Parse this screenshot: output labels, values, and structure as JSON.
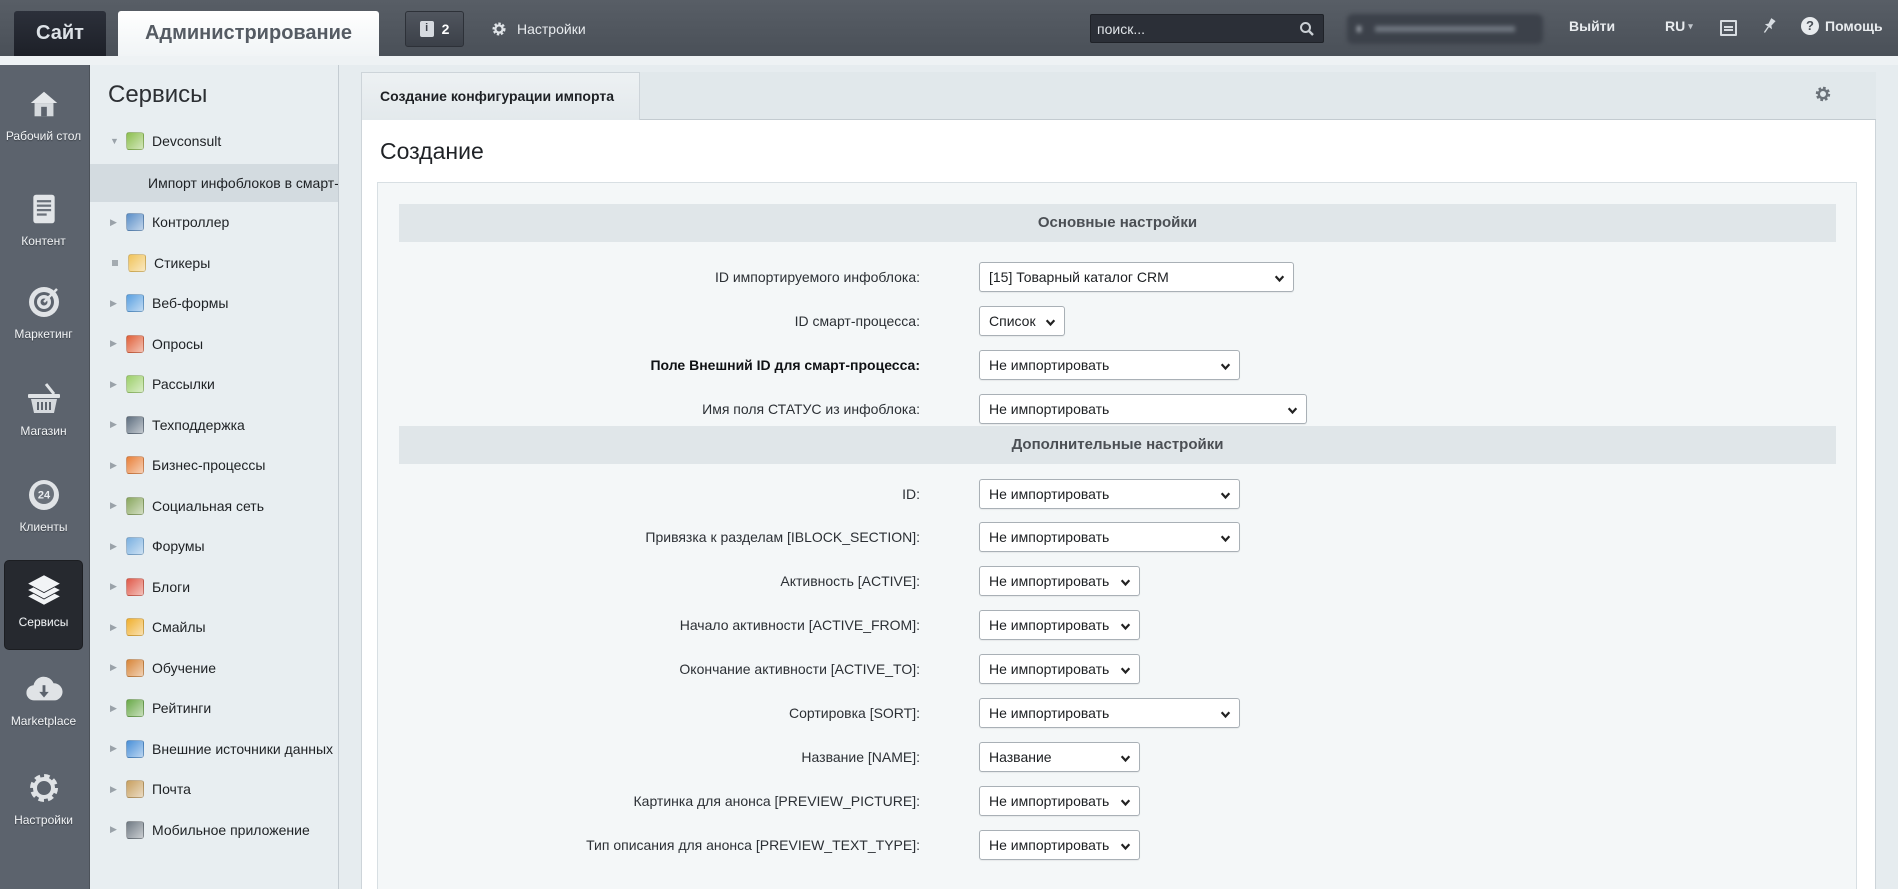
{
  "topbar": {
    "site_label": "Сайт",
    "admin_label": "Администрирование",
    "notifications_count": "2",
    "notifications_icon": "info-icon",
    "settings_label": "Настройки",
    "search_placeholder": "поиск...",
    "logout_label": "Выйти",
    "language_label": "RU",
    "help_label": "Помощь"
  },
  "iconbar": {
    "items": [
      {
        "label": "Рабочий стол",
        "icon": "home-icon",
        "active": false
      },
      {
        "label": "Контент",
        "icon": "document-icon",
        "active": false
      },
      {
        "label": "Маркетинг",
        "icon": "target-icon",
        "active": false
      },
      {
        "label": "Магазин",
        "icon": "basket-icon",
        "active": false
      },
      {
        "label": "Клиенты",
        "icon": "clients-24-icon",
        "active": false
      },
      {
        "label": "Сервисы",
        "icon": "layers-icon",
        "active": true
      },
      {
        "label": "Marketplace",
        "icon": "cloud-download-icon",
        "active": false
      },
      {
        "label": "Настройки",
        "icon": "gear-icon",
        "active": false
      }
    ]
  },
  "tree": {
    "title": "Сервисы",
    "items": [
      {
        "label": "Devconsult",
        "state": "expanded",
        "icon_color": "#8cbf4f"
      },
      {
        "label": "Импорт инфоблоков в смарт-процессы",
        "state": "child-selected"
      },
      {
        "label": "Контроллер",
        "state": "collapsed",
        "icon_color": "#5b8fc8"
      },
      {
        "label": "Стикеры",
        "state": "leaf",
        "icon_color": "#f0c35a"
      },
      {
        "label": "Веб-формы",
        "state": "collapsed",
        "icon_color": "#5aa0e0"
      },
      {
        "label": "Опросы",
        "state": "collapsed",
        "icon_color": "#e0603a"
      },
      {
        "label": "Рассылки",
        "state": "collapsed",
        "icon_color": "#9ccf6a"
      },
      {
        "label": "Техподдержка",
        "state": "collapsed",
        "icon_color": "#5f6f80"
      },
      {
        "label": "Бизнес-процессы",
        "state": "collapsed",
        "icon_color": "#e8803a"
      },
      {
        "label": "Социальная сеть",
        "state": "collapsed",
        "icon_color": "#8aa860"
      },
      {
        "label": "Форумы",
        "state": "collapsed",
        "icon_color": "#7ab0e0"
      },
      {
        "label": "Блоги",
        "state": "collapsed",
        "icon_color": "#e05a4a"
      },
      {
        "label": "Смайлы",
        "state": "collapsed",
        "icon_color": "#f0b030"
      },
      {
        "label": "Обучение",
        "state": "collapsed",
        "icon_color": "#d8863a"
      },
      {
        "label": "Рейтинги",
        "state": "collapsed",
        "icon_color": "#6aaa4a"
      },
      {
        "label": "Внешние источники данных",
        "state": "collapsed",
        "icon_color": "#4a90d8"
      },
      {
        "label": "Почта",
        "state": "collapsed",
        "icon_color": "#c8a060"
      },
      {
        "label": "Мобильное приложение",
        "state": "collapsed",
        "icon_color": "#707a84"
      }
    ]
  },
  "content": {
    "tab_label": "Создание конфигурации импорта",
    "page_title": "Создание",
    "sections": [
      {
        "title": "Основные настройки",
        "fields": [
          {
            "label": "ID импортируемого инфоблока:",
            "value": "[15] Товарный каталог CRM",
            "bold": false
          },
          {
            "label": "ID смарт-процесса:",
            "value": "Список",
            "bold": false
          },
          {
            "label": "Поле Внешний ID для смарт-процесса:",
            "value": "Не импортировать",
            "bold": true
          },
          {
            "label": "Имя поля СТАТУС из инфоблока:",
            "value": "Не импортировать",
            "bold": false
          }
        ]
      },
      {
        "title": "Дополнительные настройки",
        "fields": [
          {
            "label": "ID:",
            "value": "Не импортировать"
          },
          {
            "label": "Привязка к разделам [IBLOCK_SECTION]:",
            "value": "Не импортировать"
          },
          {
            "label": "Активность [ACTIVE]:",
            "value": "Не импортировать"
          },
          {
            "label": "Начало активности [ACTIVE_FROM]:",
            "value": "Не импортировать"
          },
          {
            "label": "Окончание активности [ACTIVE_TO]:",
            "value": "Не импортировать"
          },
          {
            "label": "Сортировка [SORT]:",
            "value": "Не импортировать"
          },
          {
            "label": "Название [NAME]:",
            "value": "Название"
          },
          {
            "label": "Картинка для анонса [PREVIEW_PICTURE]:",
            "value": "Не импортировать"
          },
          {
            "label": "Тип описания для анонса [PREVIEW_TEXT_TYPE]:",
            "value": "Не импортировать"
          }
        ]
      }
    ]
  }
}
